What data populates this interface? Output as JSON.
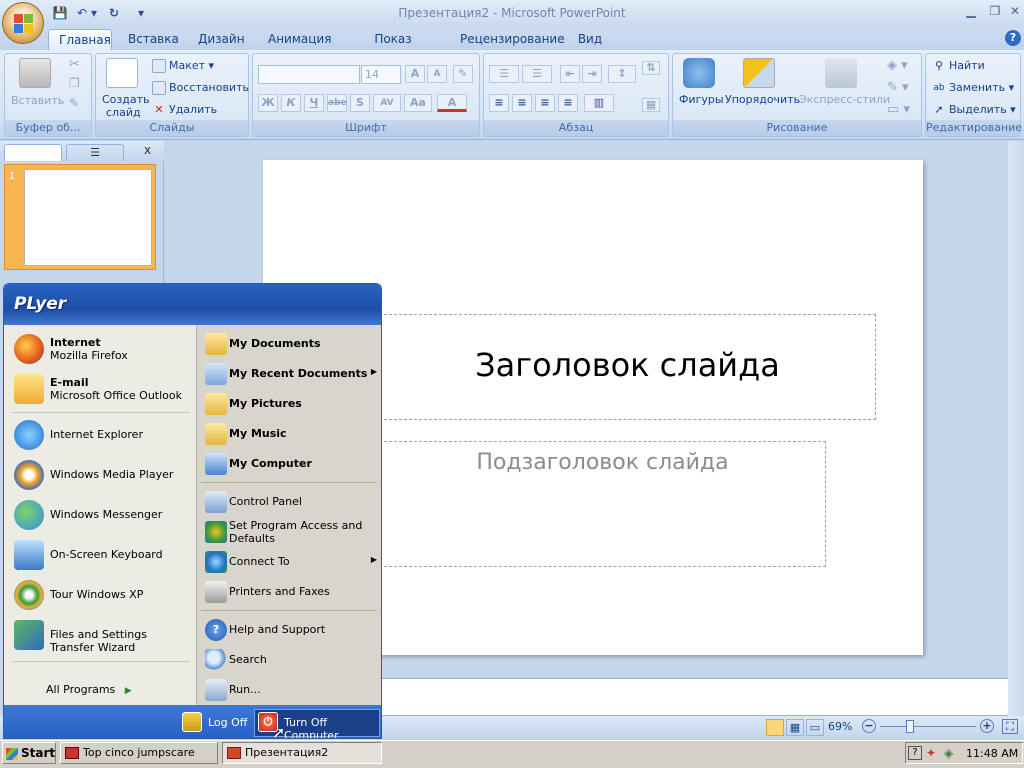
{
  "window": {
    "title": "Презентация2 - Microsoft PowerPoint",
    "minimize": "▁",
    "restore": "❐",
    "close": "✕"
  },
  "qat": {
    "save": "💾",
    "undo": "↶",
    "undo_drop": "▾",
    "redo": "↻",
    "customize": "▾"
  },
  "tabs": [
    "Главная",
    "Вставка",
    "Дизайн",
    "Анимация",
    "Показ слайдов",
    "Рецензирование",
    "Вид"
  ],
  "help_icon": "?",
  "ribbon": {
    "clipboard": {
      "label": "Буфер об...",
      "paste": "Вставить"
    },
    "slides": {
      "label": "Слайды",
      "new_slide": "Создать",
      "new_slide2": "слайд",
      "layout": "Макет",
      "reset": "Восстановить",
      "delete": "Удалить"
    },
    "font": {
      "label": "Шрифт",
      "size": "14",
      "bold": "Ж",
      "italic": "К",
      "underline": "Ч",
      "strike": "abe",
      "shadow": "S",
      "spacing": "AV",
      "case": "Aa",
      "color": "A",
      "grow": "A",
      "shrink": "A"
    },
    "paragraph": {
      "label": "Абзац"
    },
    "drawing": {
      "label": "Рисование",
      "shapes": "Фигуры",
      "arrange": "Упорядочить",
      "quick_styles": "Экспресс-стили"
    },
    "editing": {
      "label": "Редактирование",
      "find": "Найти",
      "replace": "Заменить",
      "select": "Выделить"
    }
  },
  "left_pane": {
    "slide_number": "1",
    "close": "x"
  },
  "slide": {
    "title": "Заголовок слайда",
    "subtitle": "Подзаголовок слайда"
  },
  "status": {
    "zoom": "69%",
    "zoom_minus": "−",
    "zoom_plus": "+"
  },
  "start_menu": {
    "user": "PLyer",
    "pinned": [
      {
        "title": "Internet",
        "subtitle": "Mozilla Firefox"
      },
      {
        "title": "E-mail",
        "subtitle": "Microsoft Office Outlook"
      }
    ],
    "recent": [
      "Internet Explorer",
      "Windows Media Player",
      "Windows Messenger",
      "On-Screen Keyboard",
      "Tour Windows XP",
      "Files and Settings Transfer Wizard"
    ],
    "all_programs": "All Programs",
    "right": [
      "My Documents",
      "My Recent Documents",
      "My Pictures",
      "My Music",
      "My Computer",
      "Control Panel",
      "Set Program Access and Defaults",
      "Connect To",
      "Printers and Faxes",
      "Help and Support",
      "Search",
      "Run..."
    ],
    "log_off": "Log Off",
    "turn_off": "Turn Off Computer"
  },
  "taskbar": {
    "start": "Start",
    "tasks": [
      "Top cinco jumpscare",
      "Презентация2"
    ],
    "clock": "11:48 AM"
  },
  "colors": {
    "ribbon_text": "#15428b",
    "xp_blue": "#2560c4",
    "slide_thumb_highlight": "#f7b54f"
  }
}
